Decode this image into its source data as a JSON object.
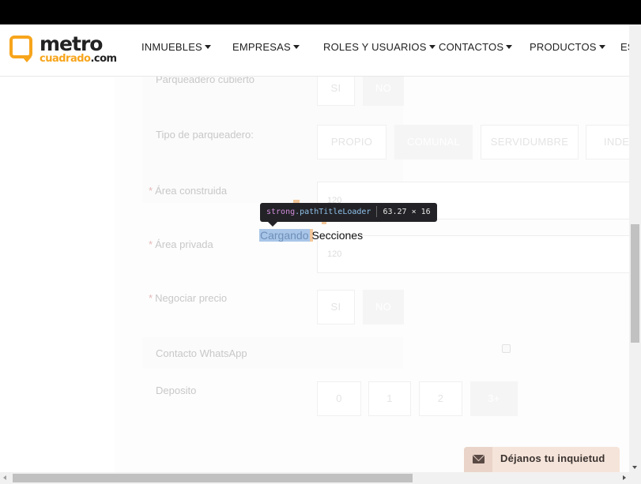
{
  "brand": {
    "line1": "metro",
    "line2_a": "cuadrado",
    "line2_b": ".com",
    "accent_color": "#f7a51c"
  },
  "nav": {
    "items": [
      {
        "label": "INMUEBLES"
      },
      {
        "label": "EMPRESAS"
      },
      {
        "label": "ROLES Y USUARIOS"
      },
      {
        "label": "CONTACTOS"
      },
      {
        "label": "PRODUCTOS"
      },
      {
        "label": "ES"
      }
    ]
  },
  "form": {
    "parqueadero_cubierto": {
      "label": "Parqueadero cubierto",
      "options": [
        "SI",
        "NO"
      ],
      "selected": "NO"
    },
    "tipo_parqueadero": {
      "label": "Tipo de parqueadero:",
      "options": [
        "PROPIO",
        "COMUNAL",
        "SERVIDUMBRE",
        "INDEP"
      ],
      "selected": "COMUNAL"
    },
    "area_construida": {
      "required_mark": "*",
      "label": "Área construida",
      "value": "120"
    },
    "area_privada": {
      "required_mark": "*",
      "label": "Área privada",
      "value": "120"
    },
    "negociar_precio": {
      "required_mark": "*",
      "label": "Negociar precio",
      "options": [
        "SI",
        "NO"
      ],
      "selected": "NO"
    },
    "contacto_whatsapp": {
      "label": "Contacto WhatsApp",
      "checked": false
    },
    "deposito": {
      "label": "Deposito",
      "options": [
        "0",
        "1",
        "2",
        "3+"
      ],
      "selected": "3+"
    }
  },
  "loader": {
    "highlight_text": "Cargando",
    "text": "Secciones"
  },
  "devtools_tooltip": {
    "tag": "strong",
    "class_name": ".pathTitleLoader",
    "dimensions": "63.27 × 16"
  },
  "feedback": {
    "label": "Déjanos tu inquietud",
    "icon": "mail-icon"
  }
}
